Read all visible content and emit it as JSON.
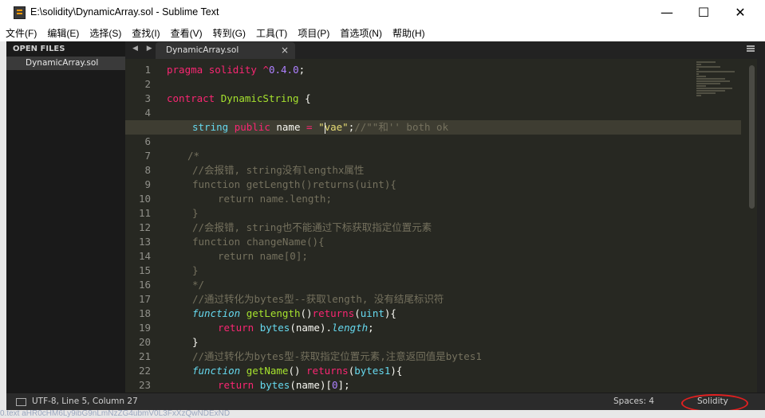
{
  "window": {
    "title": "E:\\solidity\\DynamicArray.sol - Sublime Text",
    "minimize": "—",
    "maximize": "☐",
    "close": "✕"
  },
  "menu": [
    "文件(F)",
    "编辑(E)",
    "选择(S)",
    "查找(I)",
    "查看(V)",
    "转到(G)",
    "工具(T)",
    "项目(P)",
    "首选项(N)",
    "帮助(H)"
  ],
  "sidebar": {
    "header": "OPEN FILES",
    "files": [
      "DynamicArray.sol"
    ]
  },
  "tabs": [
    {
      "label": "DynamicArray.sol",
      "close": "×"
    }
  ],
  "tab_nav": "◀ ▶",
  "editor": {
    "active_line": 5,
    "line_numbers": [
      "1",
      "2",
      "3",
      "4",
      "5",
      "6",
      "7",
      "8",
      "9",
      "10",
      "11",
      "12",
      "13",
      "14",
      "15",
      "16",
      "17",
      "18",
      "19",
      "20",
      "21",
      "22",
      "23"
    ]
  },
  "statusbar": {
    "position": "UTF-8, Line 5, Column 27",
    "spaces": "Spaces: 4",
    "syntax": "Solidity"
  },
  "background_text": "0.text  aHR0cHM6Ly9ibG9nLmNzZG4ubmV0L3FxXzQwNDExND",
  "colors": {
    "keyword": "#f92672",
    "type": "#66d9ef",
    "function": "#a6e22e",
    "string": "#e6db74",
    "number": "#ae81ff",
    "comment": "#75715e",
    "annotation": "#e02020"
  }
}
